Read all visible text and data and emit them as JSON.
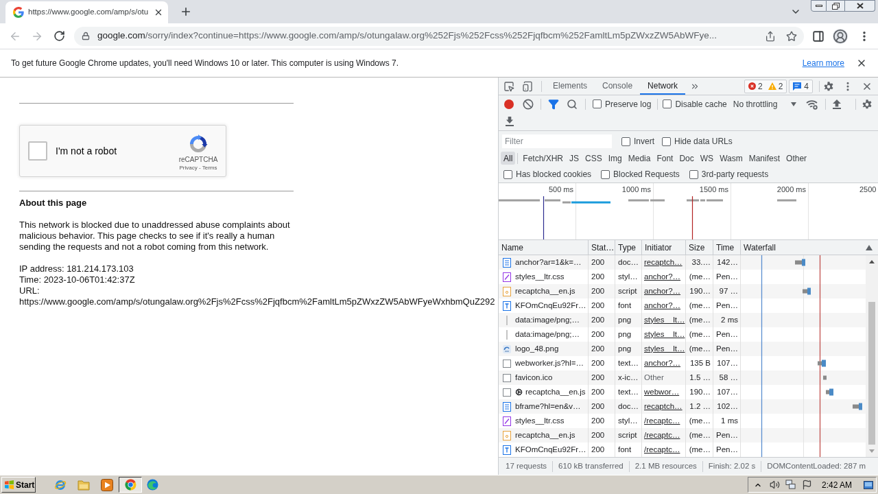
{
  "browser": {
    "tabs": [
      {
        "title": "https://www.google.com/amp/s/otu",
        "selected": true
      }
    ],
    "address": {
      "host": "google.com",
      "path": "/sorry/index?continue=https://www.google.com/amp/s/otungalaw.org%252Fjs%252Fcss%252Fjqfbcm%252FamltLm5pZWxzZW5AbWFye..."
    }
  },
  "infobar": {
    "message": "To get future Google Chrome updates, you'll need Windows 10 or later. This computer is using Windows 7.",
    "link": "Learn more"
  },
  "page": {
    "captcha": {
      "label": "I'm not a robot",
      "checked": false,
      "brand": "reCAPTCHA",
      "legal": "Privacy - Terms"
    },
    "heading": "About this page",
    "paragraph": "This network is blocked due to unaddressed abuse complaints about malicious behavior. This page checks to see if it's really a human sending the requests and not a robot coming from this network.",
    "details": [
      "IP address: 181.214.173.103",
      "Time: 2023-10-06T01:42:37Z",
      "URL:",
      "https://www.google.com/amp/s/otungalaw.org%2Fjs%2Fcss%2Fjqfbcm%2FamltLm5pZWxzZW5AbWFyeWxhbmQuZ292"
    ]
  },
  "devtools": {
    "tabs": [
      {
        "label": "Elements",
        "selected": false
      },
      {
        "label": "Console",
        "selected": false
      },
      {
        "label": "Network",
        "selected": true
      }
    ],
    "issues": {
      "errors": "2",
      "warnings": "2",
      "messages": "4"
    },
    "toolbar": {
      "recording": true,
      "options": [
        {
          "label": "Preserve log",
          "checked": false
        },
        {
          "label": "Disable cache",
          "checked": false
        }
      ],
      "throttling": "No throttling"
    },
    "filter": {
      "placeholder": "Filter",
      "options": [
        {
          "label": "Invert",
          "checked": false
        },
        {
          "label": "Hide data URLs",
          "checked": false
        }
      ]
    },
    "types": [
      {
        "label": "All",
        "selected": true
      },
      {
        "label": "Fetch/XHR",
        "selected": false
      },
      {
        "label": "JS",
        "selected": false
      },
      {
        "label": "CSS",
        "selected": false
      },
      {
        "label": "Img",
        "selected": false
      },
      {
        "label": "Media",
        "selected": false
      },
      {
        "label": "Font",
        "selected": false
      },
      {
        "label": "Doc",
        "selected": false
      },
      {
        "label": "WS",
        "selected": false
      },
      {
        "label": "Wasm",
        "selected": false
      },
      {
        "label": "Manifest",
        "selected": false
      },
      {
        "label": "Other",
        "selected": false
      }
    ],
    "request_filters": [
      {
        "label": "Has blocked cookies",
        "checked": false
      },
      {
        "label": "Blocked Requests",
        "checked": false
      },
      {
        "label": "3rd-party requests",
        "checked": false
      }
    ],
    "overview_ticks": [
      "500 ms",
      "1000 ms",
      "1500 ms",
      "2000 ms",
      "2500"
    ],
    "table": {
      "columns": [
        "Name",
        "Stat…",
        "Type",
        "Initiator",
        "Size",
        "Time",
        "Waterfall"
      ],
      "rows": [
        {
          "name": "anchor?ar=1&k=…",
          "kind": "doc",
          "worker": false,
          "status": "200",
          "type": "doc…",
          "initiator": "recaptch…",
          "initiator_link": true,
          "size": "33.…",
          "time": "142…"
        },
        {
          "name": "styles__ltr.css",
          "kind": "css",
          "worker": false,
          "status": "200",
          "type": "styl…",
          "initiator": "anchor?…",
          "initiator_link": true,
          "size": "(me…",
          "time": "Pen…"
        },
        {
          "name": "recaptcha__en.js",
          "kind": "script",
          "worker": false,
          "status": "200",
          "type": "script",
          "initiator": "anchor?…",
          "initiator_link": true,
          "size": "190…",
          "time": "97 …"
        },
        {
          "name": "KFOmCnqEu92Fr…",
          "kind": "font",
          "worker": false,
          "status": "200",
          "type": "font",
          "initiator": "anchor?…",
          "initiator_link": true,
          "size": "(me…",
          "time": "Pen…"
        },
        {
          "name": "data:image/png;…",
          "kind": "data",
          "worker": false,
          "status": "200",
          "type": "png",
          "initiator": "styles__lt…",
          "initiator_link": true,
          "size": "(me…",
          "time": "2 ms"
        },
        {
          "name": "data:image/png;…",
          "kind": "data",
          "worker": false,
          "status": "200",
          "type": "png",
          "initiator": "styles__lt…",
          "initiator_link": true,
          "size": "(me…",
          "time": "Pen…"
        },
        {
          "name": "logo_48.png",
          "kind": "image",
          "worker": false,
          "status": "200",
          "type": "png",
          "initiator": "styles__lt…",
          "initiator_link": true,
          "size": "(me…",
          "time": "Pen…"
        },
        {
          "name": "webworker.js?hl=…",
          "kind": "other",
          "worker": false,
          "status": "200",
          "type": "text…",
          "initiator": "anchor?…",
          "initiator_link": true,
          "size": "135 B",
          "time": "107…"
        },
        {
          "name": "favicon.ico",
          "kind": "other",
          "worker": false,
          "status": "200",
          "type": "x-ic…",
          "initiator": "Other",
          "initiator_link": false,
          "size": "1.5 …",
          "time": "58 …"
        },
        {
          "name": "recaptcha__en.js",
          "kind": "other",
          "worker": true,
          "status": "200",
          "type": "text…",
          "initiator": "webwor…",
          "initiator_link": true,
          "size": "190…",
          "time": "107…"
        },
        {
          "name": "bframe?hl=en&v…",
          "kind": "doc",
          "worker": false,
          "status": "200",
          "type": "doc…",
          "initiator": "recaptch…",
          "initiator_link": true,
          "size": "1.2 …",
          "time": "102…"
        },
        {
          "name": "styles__ltr.css",
          "kind": "css",
          "worker": false,
          "status": "200",
          "type": "styl…",
          "initiator": "/recaptc…",
          "initiator_link": true,
          "size": "(me…",
          "time": "1 ms"
        },
        {
          "name": "recaptcha__en.js",
          "kind": "script",
          "worker": false,
          "status": "200",
          "type": "script",
          "initiator": "/recaptc…",
          "initiator_link": true,
          "size": "(me…",
          "time": "Pen…"
        },
        {
          "name": "KFOmCnqEu92Fr…",
          "kind": "font",
          "worker": false,
          "status": "200",
          "type": "font",
          "initiator": "/recaptc…",
          "initiator_link": true,
          "size": "(me…",
          "time": "Pen…"
        }
      ]
    },
    "summary": [
      "17 requests",
      "610 kB transferred",
      "2.1 MB resources",
      "Finish: 2.02 s",
      "DOMContentLoaded: 287 m"
    ]
  },
  "taskbar": {
    "start": "Start",
    "clock": "2:42 AM"
  }
}
